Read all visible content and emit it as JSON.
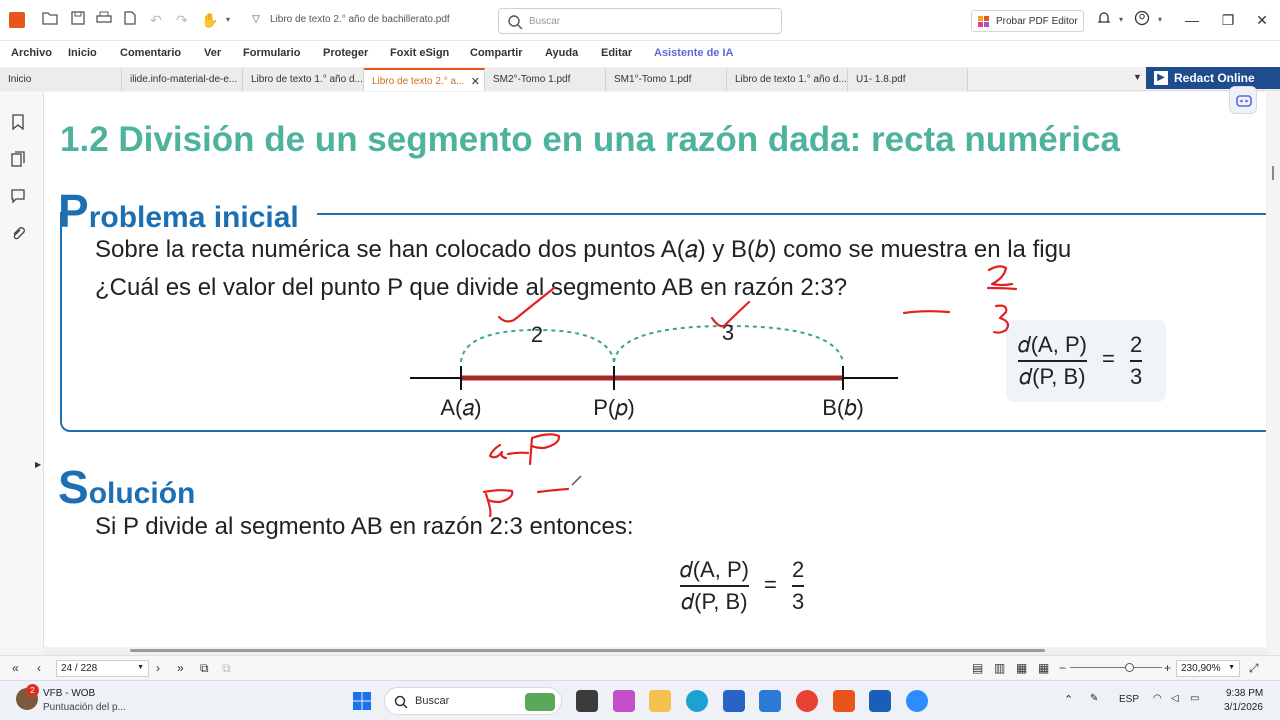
{
  "titlebar": {
    "document_title": "Libro de texto 2.° año de bachillerato.pdf",
    "search_placeholder": "Buscar",
    "try_button": "Probar PDF Editor"
  },
  "menu": [
    "Archivo",
    "Inicio",
    "Comentario",
    "Ver",
    "Formulario",
    "Proteger",
    "Foxit eSign",
    "Compartir",
    "Ayuda",
    "Editar",
    "Asistente de IA"
  ],
  "tabs": [
    {
      "label": "Inicio"
    },
    {
      "label": "ilide.info-material-de-e..."
    },
    {
      "label": "Libro de texto 1.° año d..."
    },
    {
      "label": "Libro de texto 2.° a..."
    },
    {
      "label": "SM2°-Tomo 1.pdf"
    },
    {
      "label": "SM1°-Tomo 1.pdf"
    },
    {
      "label": "Libro de texto 1.° año d..."
    },
    {
      "label": "U1- 1.8.pdf"
    }
  ],
  "redact_button": "Redact Online",
  "page": {
    "heading": "1.2 División de un segmento en una razón dada: recta numérica",
    "problem_cap": "P",
    "problem_rest": "roblema inicial",
    "problem_line1": "Sobre la recta numérica se han colocado dos puntos A(𝑎) y B(𝑏) como se muestra en la figu",
    "problem_line2": "¿Cuál es el valor del punto P que divide al segmento AB en razón 2:3?",
    "diagram": {
      "arc_left_label": "2",
      "arc_right_label": "3",
      "point_a": "A(𝑎)",
      "point_p": "P(𝑝)",
      "point_b": "B(𝑏)"
    },
    "ratio_card": {
      "num": "𝑑(A, P)",
      "den": "𝑑(P, B)",
      "eq": "=",
      "rnum": "2",
      "rden": "3"
    },
    "solution_cap": "S",
    "solution_rest": "olución",
    "solution_line1": "Si P divide al segmento AB en razón 2:3 entonces:",
    "solution_formula": {
      "num": "𝑑(A, P)",
      "den": "𝑑(P, B)",
      "eq": "=",
      "rnum": "2",
      "rden": "3"
    }
  },
  "status": {
    "page_indicator": "24 / 228",
    "zoom": "230,90%"
  },
  "taskbar": {
    "weather_badge": "2",
    "widget_title": "VFB - WOB",
    "widget_sub": "Puntuación del p...",
    "search_label": "Buscar",
    "lang": "ESP",
    "time": "9:38 PM",
    "date": "3/1/2026"
  },
  "colors": {
    "heading_green": "#4db39c",
    "section_blue": "#1d6fb3",
    "segment_red": "#a52a2a",
    "arc_teal": "#3aa394",
    "annotation_red": "#e32020",
    "accent_orange": "#e8541c"
  }
}
